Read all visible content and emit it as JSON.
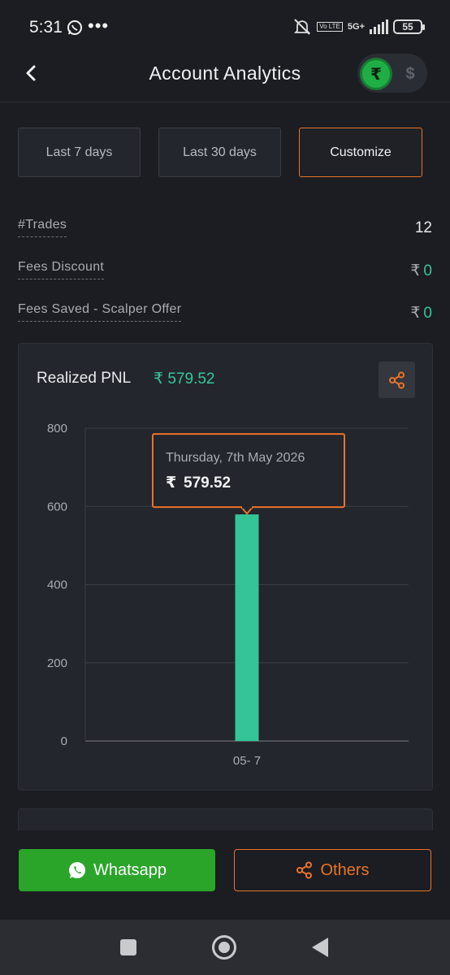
{
  "status_bar": {
    "time": "5:31",
    "network": "5G+",
    "volte": "Vo LTE",
    "battery": "55"
  },
  "header": {
    "title": "Account Analytics",
    "currency_inr_symbol": "₹",
    "currency_usd_symbol": "$"
  },
  "tabs": [
    {
      "label": "Last 7 days",
      "active": false
    },
    {
      "label": "Last 30 days",
      "active": false
    },
    {
      "label": "Customize",
      "active": true
    }
  ],
  "stats": {
    "trades_label": "#Trades",
    "trades_value": "12",
    "fees_discount_label": "Fees Discount",
    "fees_discount_currency": "₹",
    "fees_discount_value": "0",
    "fees_saved_label": "Fees Saved - Scalper Offer",
    "fees_saved_currency": "₹",
    "fees_saved_value": "0"
  },
  "chart_card": {
    "title": "Realized PNL",
    "total": "₹ 579.52",
    "tooltip_date": "Thursday, 7th May 2026",
    "tooltip_currency": "₹",
    "tooltip_value": "579.52"
  },
  "chart_data": {
    "type": "bar",
    "categories": [
      "05- 7"
    ],
    "values": [
      579.52
    ],
    "title": "Realized PNL",
    "xlabel": "",
    "ylabel": "",
    "ylim": [
      0,
      800
    ],
    "yticks": [
      0,
      200,
      400,
      600,
      800
    ],
    "grid": true,
    "bar_color": "#35c496"
  },
  "share_bar": {
    "whatsapp_label": "Whatsapp",
    "others_label": "Others"
  },
  "colors": {
    "accent_orange": "#e9732b",
    "profit_green": "#38c49a",
    "whatsapp_green": "#2aa52a",
    "background": "#1b1d22",
    "card": "#23262c"
  }
}
